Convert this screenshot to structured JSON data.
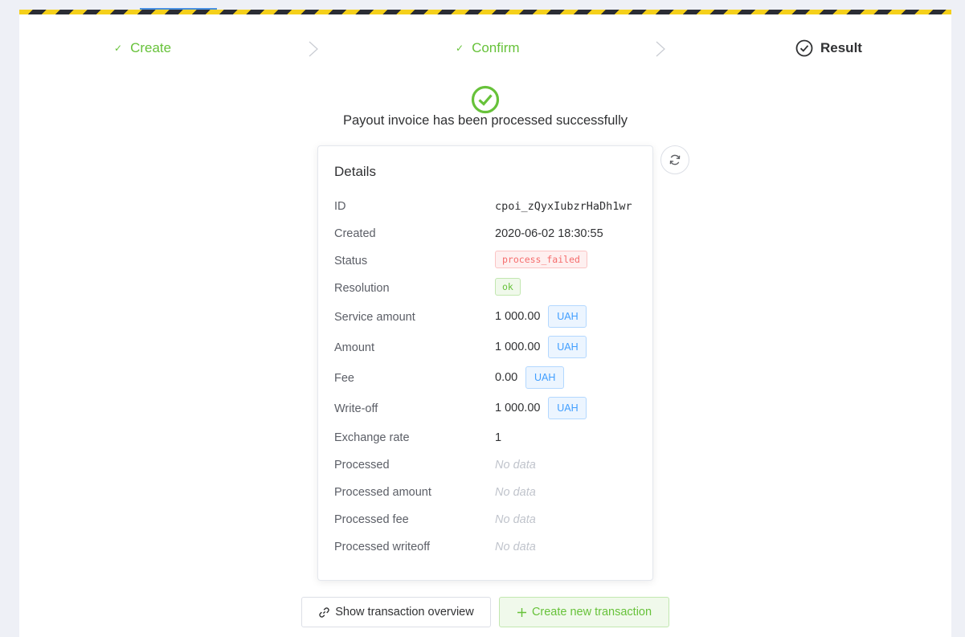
{
  "steps": [
    {
      "label": "Create",
      "state": "done"
    },
    {
      "label": "Confirm",
      "state": "done"
    },
    {
      "label": "Result",
      "state": "active"
    }
  ],
  "success_message": "Payout invoice has been processed successfully",
  "details": {
    "title": "Details",
    "id_label": "ID",
    "id_value": "cpoi_zQyxIubzrHaDh1wr",
    "created_label": "Created",
    "created_value": "2020-06-02 18:30:55",
    "status_label": "Status",
    "status_value": "process_failed",
    "resolution_label": "Resolution",
    "resolution_value": "ok",
    "service_amount_label": "Service amount",
    "service_amount_value": "1 000.00",
    "service_amount_currency": "UAH",
    "amount_label": "Amount",
    "amount_value": "1 000.00",
    "amount_currency": "UAH",
    "fee_label": "Fee",
    "fee_value": "0.00",
    "fee_currency": "UAH",
    "writeoff_label": "Write-off",
    "writeoff_value": "1 000.00",
    "writeoff_currency": "UAH",
    "exchange_rate_label": "Exchange rate",
    "exchange_rate_value": "1",
    "processed_label": "Processed",
    "processed_amount_label": "Processed amount",
    "processed_fee_label": "Processed fee",
    "processed_writeoff_label": "Processed writeoff",
    "no_data": "No data"
  },
  "buttons": {
    "overview": "Show transaction overview",
    "create": "Create new transaction"
  },
  "colors": {
    "success": "#67c23a",
    "danger": "#f56c6c",
    "primary": "#409eff",
    "hazard_yellow": "#f5d01a",
    "hazard_dark": "#2b2d34"
  }
}
